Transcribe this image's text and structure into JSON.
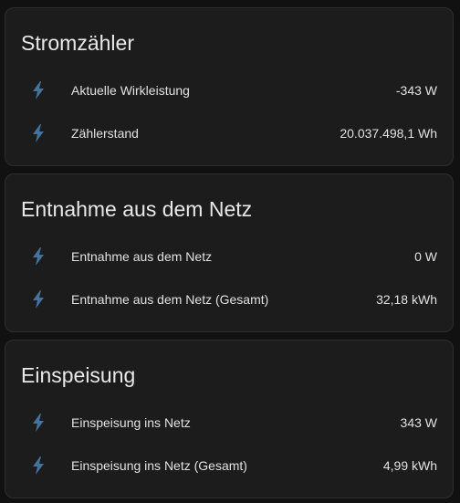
{
  "icon_color": "#44739e",
  "cards": [
    {
      "title": "Stromzähler",
      "rows": [
        {
          "icon": "flash-icon",
          "label": "Aktuelle Wirkleistung",
          "value": "-343 W"
        },
        {
          "icon": "flash-icon",
          "label": "Zählerstand",
          "value": "20.037.498,1 Wh"
        }
      ]
    },
    {
      "title": "Entnahme aus dem Netz",
      "rows": [
        {
          "icon": "flash-icon",
          "label": "Entnahme aus dem Netz",
          "value": "0 W"
        },
        {
          "icon": "flash-icon",
          "label": "Entnahme aus dem Netz (Gesamt)",
          "value": "32,18 kWh"
        }
      ]
    },
    {
      "title": "Einspeisung",
      "rows": [
        {
          "icon": "flash-icon",
          "label": "Einspeisung ins Netz",
          "value": "343 W"
        },
        {
          "icon": "flash-icon",
          "label": "Einspeisung ins Netz (Gesamt)",
          "value": "4,99 kWh"
        }
      ]
    }
  ]
}
